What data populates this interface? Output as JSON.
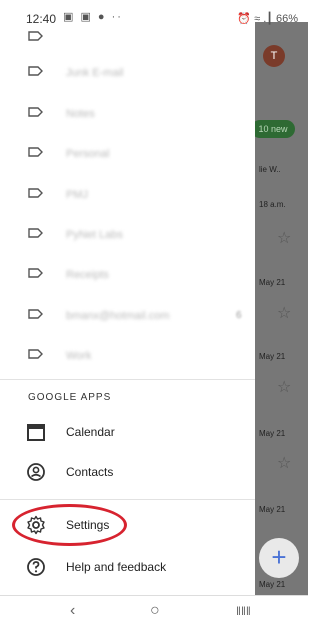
{
  "status": {
    "time": "12:40",
    "right": "⏰ ≈ .┃ 66%"
  },
  "background": {
    "avatar": "T",
    "new_badge": "10 new",
    "snippets": [
      {
        "text": "lie W.."
      },
      {
        "text": "18 a.m."
      },
      {
        "text": "May 21"
      },
      {
        "text": "May 21"
      },
      {
        "text": "May 21"
      },
      {
        "text": "May 21"
      },
      {
        "text": "May 21"
      },
      {
        "text": "May 21"
      }
    ]
  },
  "labels": [
    {
      "name": "Junk E-mail"
    },
    {
      "name": "Notes"
    },
    {
      "name": "Personal"
    },
    {
      "name": "PMJ"
    },
    {
      "name": "PyNet Labs"
    },
    {
      "name": "Receipts"
    },
    {
      "name": "bmanx@hotmail.com",
      "count": "6"
    },
    {
      "name": "Work"
    }
  ],
  "section_title": "GOOGLE APPS",
  "apps": [
    {
      "label": "Calendar",
      "icon": "calendar-icon"
    },
    {
      "label": "Contacts",
      "icon": "contacts-icon"
    }
  ],
  "settings": {
    "label": "Settings",
    "icon": "gear-icon",
    "highlight_color": "#d7232f"
  },
  "help": {
    "label": "Help and feedback",
    "icon": "help-icon"
  },
  "system_nav": {
    "back": "‹",
    "home": "○",
    "recents": "‖‖‖"
  }
}
